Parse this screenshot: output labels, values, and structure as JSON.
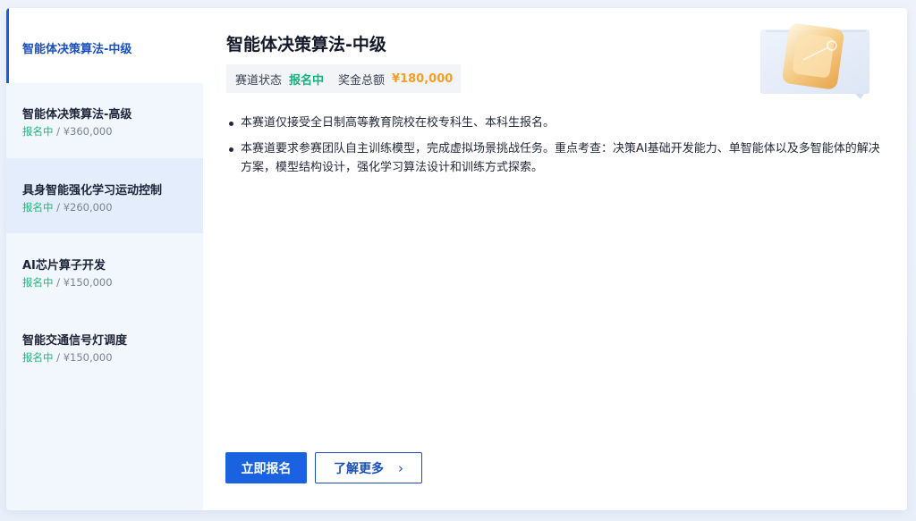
{
  "sidebar": {
    "items": [
      {
        "title": "智能体决策算法-中级",
        "status": "",
        "prize": "",
        "sep": ""
      },
      {
        "title": "智能体决策算法-高级",
        "status": "报名中",
        "sep": " / ",
        "prize": "¥360,000"
      },
      {
        "title": "具身智能强化学习运动控制",
        "status": "报名中",
        "sep": " / ",
        "prize": "¥260,000"
      },
      {
        "title": "AI芯片算子开发",
        "status": "报名中",
        "sep": " / ",
        "prize": "¥150,000"
      },
      {
        "title": "智能交通信号灯调度",
        "status": "报名中",
        "sep": " / ",
        "prize": "¥150,000"
      }
    ]
  },
  "main": {
    "title": "智能体决策算法-中级",
    "status_label": "赛道状态",
    "status_value": "报名中",
    "prize_label": "奖金总额",
    "prize_value": "¥180,000",
    "description": [
      "本赛道仅接受全日制高等教育院校在校专科生、本科生报名。",
      "本赛道要求参赛团队自主训练模型，完成虚拟场景挑战任务。重点考查：决策AI基础开发能力、单智能体以及多智能体的解决方案，模型结构设计，强化学习算法设计和训练方式探索。"
    ],
    "register_button": "立即报名",
    "learn_more_button": "了解更多",
    "learn_more_icon": "chevron-right-icon"
  },
  "colors": {
    "accent": "#1a63e0",
    "status_green": "#14b37a",
    "prize_orange": "#f59f26"
  }
}
